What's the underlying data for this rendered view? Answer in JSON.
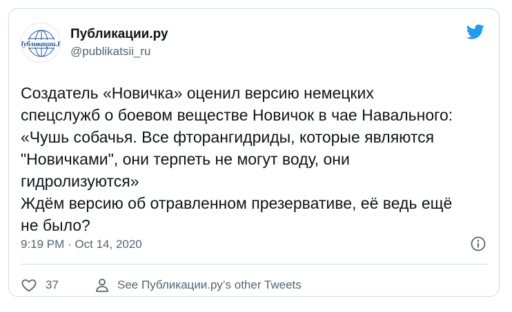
{
  "author": {
    "display_name": "Публикации.ру",
    "handle": "@publikatsii_ru",
    "avatar_text": "Публикации.Ру"
  },
  "tweet": {
    "lines": [
      "Создатель «Новичка» оценил версию немецких",
      "спецслужб о боевом веществе Новичок в чае Навального:",
      "«Чушь собачья. Все фторангидриды, которые являются",
      "\"Новичками\", они терпеть не могут воду, они",
      "гидролизуются»",
      "Ждём версию об отравленном презервативе, её ведь ещё",
      "не было?"
    ],
    "timestamp": "9:19 PM · Oct 14, 2020"
  },
  "actions": {
    "like_count": "37",
    "profile_link": "See Публикации.ру’s other Tweets"
  },
  "icons": {
    "brand": "twitter-bird-icon",
    "info": "info-icon",
    "like": "heart-icon",
    "profile": "person-icon"
  },
  "colors": {
    "twitter_blue": "#1d9bf0",
    "text_primary": "#0f1419",
    "text_secondary": "#536471",
    "border": "#cfd9de",
    "avatar_blue": "#1b4f9c"
  }
}
